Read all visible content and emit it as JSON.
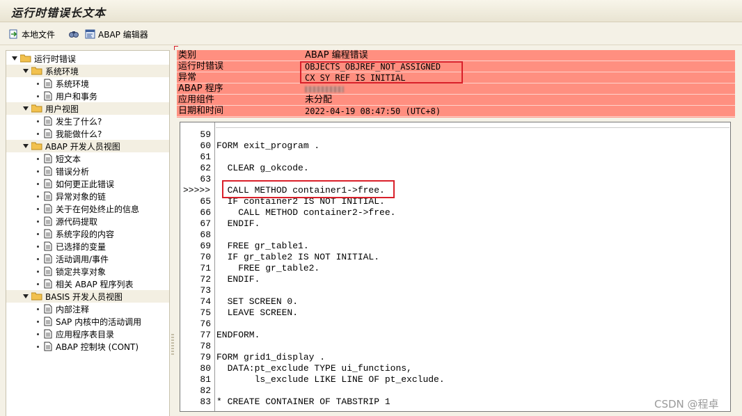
{
  "window": {
    "title": "运行时错误长文本"
  },
  "toolbar": {
    "local_file_label": "本地文件",
    "abap_editor_label": "ABAP 编辑器"
  },
  "tree": {
    "root": "运行时错误",
    "groups": [
      {
        "label": "系统环境",
        "items": [
          "系统环境",
          "用户和事务"
        ]
      },
      {
        "label": "用户视图",
        "items": [
          "发生了什么?",
          "我能做什么?"
        ]
      },
      {
        "label": "ABAP 开发人员视图",
        "items": [
          "短文本",
          "错误分析",
          "如何更正此错误",
          "异常对象的链",
          "关于在何处终止的信息",
          "源代码提取",
          "系统字段的内容",
          "已选择的变量",
          "活动调用/事件",
          "锁定共享对象",
          "相关 ABAP 程序列表"
        ]
      },
      {
        "label": "BASIS 开发人员视图",
        "items": [
          "内部注释",
          "SAP 内核中的活动调用",
          "应用程序表目录",
          "ABAP 控制块 (CONT)"
        ]
      }
    ]
  },
  "info": {
    "rows": [
      {
        "key": "类别",
        "value": "ABAP 编程错误"
      },
      {
        "key": "运行时错误",
        "value": "OBJECTS_OBJREF_NOT_ASSIGNED"
      },
      {
        "key": "异常",
        "value": "CX_SY_REF_IS_INITIAL"
      },
      {
        "key": "ABAP 程序",
        "value": ""
      },
      {
        "key": "应用组件",
        "value": "未分配"
      },
      {
        "key": "日期和时间",
        "value": "2022-04-19 08:47:50 (UTC+8)"
      }
    ]
  },
  "code": {
    "current_marker": ">>>>>",
    "lines": [
      {
        "num": "59",
        "text": ""
      },
      {
        "num": "60",
        "text": "FORM exit_program ."
      },
      {
        "num": "61",
        "text": ""
      },
      {
        "num": "62",
        "text": "  CLEAR g_okcode."
      },
      {
        "num": "63",
        "text": ""
      },
      {
        "num": "",
        "text": "  CALL METHOD container1->free."
      },
      {
        "num": "65",
        "text": "  IF container2 IS NOT INITIAL."
      },
      {
        "num": "66",
        "text": "    CALL METHOD container2->free."
      },
      {
        "num": "67",
        "text": "  ENDIF."
      },
      {
        "num": "68",
        "text": ""
      },
      {
        "num": "69",
        "text": "  FREE gr_table1."
      },
      {
        "num": "70",
        "text": "  IF gr_table2 IS NOT INITIAL."
      },
      {
        "num": "71",
        "text": "    FREE gr_table2."
      },
      {
        "num": "72",
        "text": "  ENDIF."
      },
      {
        "num": "73",
        "text": ""
      },
      {
        "num": "74",
        "text": "  SET SCREEN 0."
      },
      {
        "num": "75",
        "text": "  LEAVE SCREEN."
      },
      {
        "num": "76",
        "text": ""
      },
      {
        "num": "77",
        "text": "ENDFORM."
      },
      {
        "num": "78",
        "text": ""
      },
      {
        "num": "79",
        "text": "FORM grid1_display ."
      },
      {
        "num": "80",
        "text": "  DATA:pt_exclude TYPE ui_functions,"
      },
      {
        "num": "81",
        "text": "       ls_exclude LIKE LINE OF pt_exclude."
      },
      {
        "num": "82",
        "text": ""
      },
      {
        "num": "83",
        "text": "* CREATE CONTAINER OF TABSTRIP 1"
      }
    ]
  },
  "watermark": "CSDN @程卓",
  "colors": {
    "header_bg": "#ff8f80",
    "highlight_box": "#d9202a"
  }
}
